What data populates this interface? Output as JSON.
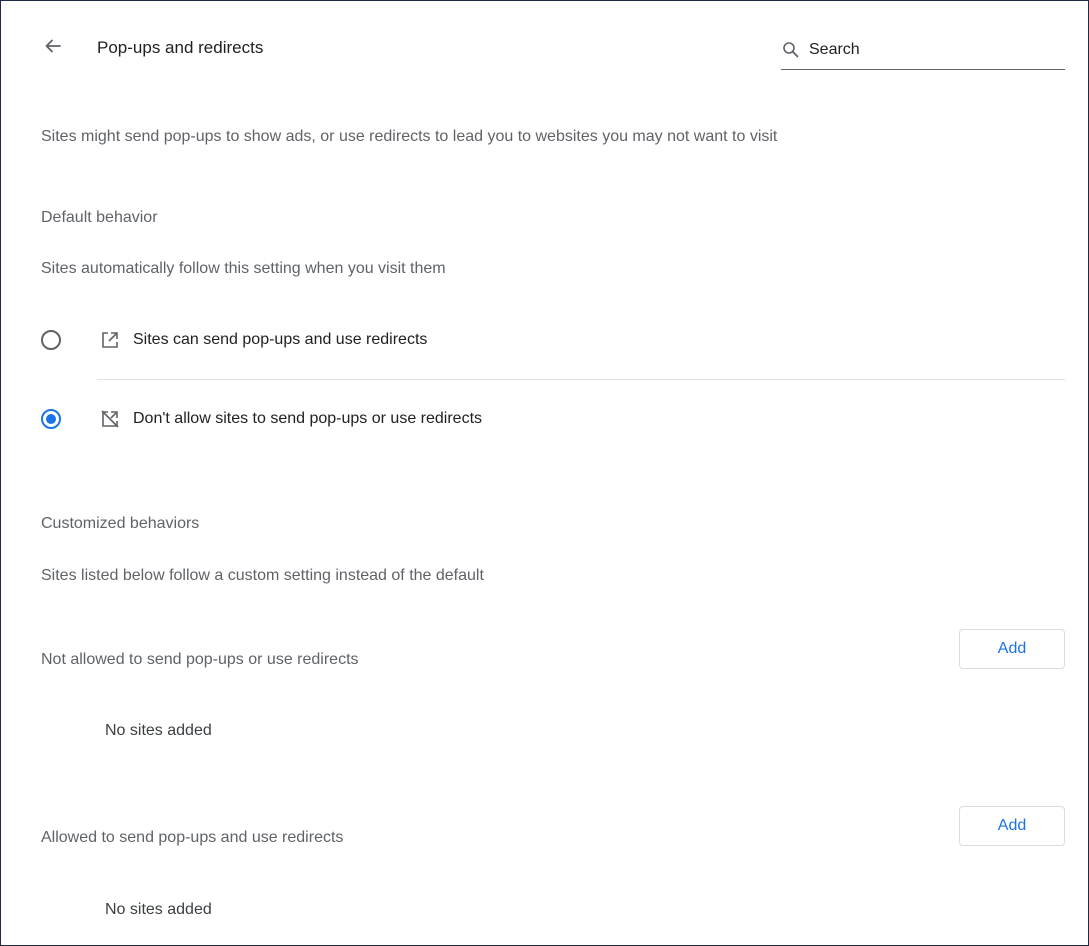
{
  "header": {
    "title": "Pop-ups and redirects",
    "search_placeholder": "Search"
  },
  "description": "Sites might send pop-ups to show ads, or use redirects to lead you to websites you may not want to visit",
  "default_behavior": {
    "heading": "Default behavior",
    "subtext": "Sites automatically follow this setting when you visit them",
    "options": [
      {
        "label": "Sites can send pop-ups and use redirects",
        "icon": "open-in-new-icon",
        "checked": false
      },
      {
        "label": "Don't allow sites to send pop-ups or use redirects",
        "icon": "popup-blocked-icon",
        "checked": true
      }
    ],
    "accent_color": "#1a73e8"
  },
  "customized_behaviors": {
    "heading": "Customized behaviors",
    "subtext": "Sites listed below follow a custom setting instead of the default",
    "lists": [
      {
        "label": "Not allowed to send pop-ups or use redirects",
        "add_label": "Add",
        "empty_text": "No sites added"
      },
      {
        "label": "Allowed to send pop-ups and use redirects",
        "add_label": "Add",
        "empty_text": "No sites added"
      }
    ]
  }
}
